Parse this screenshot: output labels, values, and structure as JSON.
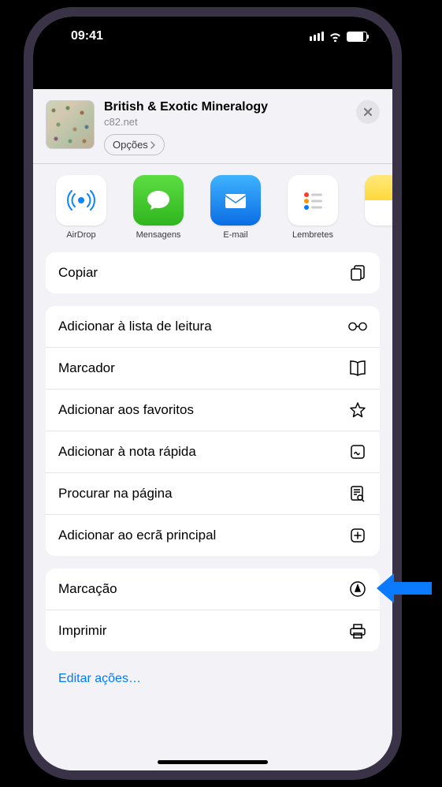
{
  "statusBar": {
    "time": "09:41"
  },
  "header": {
    "title": "British & Exotic Mineralogy",
    "url": "c82.net",
    "optionsLabel": "Opções"
  },
  "apps": [
    {
      "label": "AirDrop",
      "name": "airdrop"
    },
    {
      "label": "Mensagens",
      "name": "messages"
    },
    {
      "label": "E-mail",
      "name": "mail"
    },
    {
      "label": "Lembretes",
      "name": "reminders"
    },
    {
      "label": "",
      "name": "notes"
    }
  ],
  "sections": [
    {
      "items": [
        {
          "label": "Copiar",
          "icon": "copy"
        }
      ]
    },
    {
      "items": [
        {
          "label": "Adicionar à lista de leitura",
          "icon": "glasses"
        },
        {
          "label": "Marcador",
          "icon": "book"
        },
        {
          "label": "Adicionar aos favoritos",
          "icon": "star"
        },
        {
          "label": "Adicionar à nota rápida",
          "icon": "quicknote"
        },
        {
          "label": "Procurar na página",
          "icon": "findpage"
        },
        {
          "label": "Adicionar ao ecrã principal",
          "icon": "addhome"
        }
      ]
    },
    {
      "items": [
        {
          "label": "Marcação",
          "icon": "markup"
        },
        {
          "label": "Imprimir",
          "icon": "print"
        }
      ]
    }
  ],
  "editLink": "Editar ações…"
}
